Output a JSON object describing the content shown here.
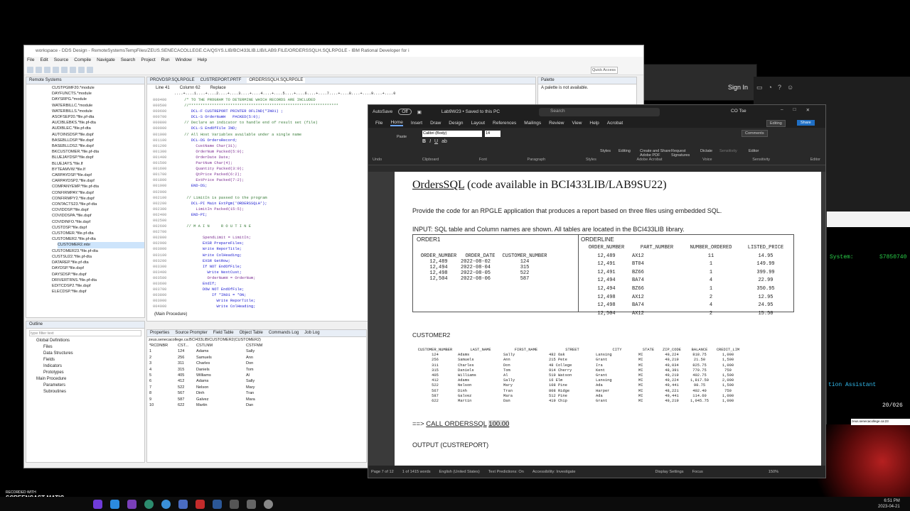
{
  "back_window": {
    "signin": "Sign In"
  },
  "terminal": {
    "line1_label": "System:",
    "line1_value": "S7850740",
    "assistant": "tion Assistant",
    "page": "20/026",
    "address": "zeus.senecacollege.ca:23"
  },
  "eclipse": {
    "title": "workspace - DDS Design - RemoteSystemsTempFiles/ZEUS.SENECACOLLEGE.CA/QSYS.LIB/BCI433LIB.LIB/LAB9.FILE/ORDERSSQLH.SQLRPGLE - IBM Rational Developer for i",
    "menu": [
      "File",
      "Edit",
      "Source",
      "Compile",
      "Navigate",
      "Search",
      "Project",
      "Run",
      "Window",
      "Help"
    ],
    "quick_access": "Quick Access",
    "remote_tab": "Remote Systems",
    "tree": [
      "CUSTPGMF20.*module",
      "DAYFUNCTS.*module",
      "DAYSRPG.*module",
      "WATERBILLC.*module",
      "WATERBILLS.*module",
      "ASOFSEP20.*file.pf-dta",
      "AUCIBLEBKS.*file.pf-dta",
      "AUDIBLEC.*file.pf-dta",
      "AUTOINSDSP.*file.dspf",
      "BASEBLLDSP.*file.dspf",
      "BASEBLLDS2.*file.dspf",
      "BKCUSTOMER.*file.pf-dta",
      "BLUEJAYDSP.*file.dspf",
      "BLUEJAYS.*file.lf",
      "BYTEAMVW.*file.lf",
      "CARPAYDSP.*file.dspf",
      "CARPAYDSP2.*file.dspf",
      "COMPANYEMP.*file.pf-dta",
      "CONFIRMPAY.*file.dspf",
      "CONFIRMPY2.*file.dspf",
      "CONTACTS23.*file.pf-dta",
      "COVIDDSP.*file.dspf",
      "COVIDDSPA.*file.dspf",
      "COVIDINFO.*file.dspf",
      "CUSTDSP.*file.dspf",
      "CUSTOMER.*file.pf-dta",
      "CUSTOMER2.*file.pf-dta",
      "CUSTOMER2.mbr",
      "CUSTOMER23.*file.pf-dta",
      "CUSTSU22.*file.pf-dta",
      "DATAREP.*file.pf-dta",
      "DAYDSP.*file.dspf",
      "DAYSDSP.*file.dspf",
      "DRIVERTRNS.*file.pf-dta",
      "EDITCDSP2.*file.dspf",
      "ELECDSP.*file.dspf"
    ],
    "editor_tabs": [
      "PROVDSP.SQLRPGLE",
      "CUSTREPORT.PRTF",
      "ORDERSSQLH.SQLRPGLE"
    ],
    "line_info": "Line 41",
    "col_info": "Column 62",
    "mode": "Replace",
    "ruler": "....+....1....+....2....+....3....+....4....+....5....+....6....+....7....+....8....+....9....+....0",
    "code": [
      {
        "n": "000400",
        "t": "     /* TO THE PROGRAM TO DETERMINE WHICH RECORDS ARE INCLUDED",
        "c": "c"
      },
      {
        "n": "000500",
        "t": "     //*****************************************************************",
        "c": "c"
      },
      {
        "n": "000600",
        "t": "        DCL-F CUSTREPORT PRINTER OFLIND(*IN01) ;",
        "c": "k"
      },
      {
        "n": "000700",
        "t": "        DCL-S OrderNumH   PACKED(5:0);",
        "c": "k"
      },
      {
        "n": "000800",
        "t": "     // Declare an indicator to handle end of result set (file)",
        "c": "c"
      },
      {
        "n": "000900",
        "t": "        DCL-S EndOfFile IND;",
        "c": "k"
      },
      {
        "n": "001000",
        "t": "     // All Host Variables available under a single name",
        "c": "c"
      },
      {
        "n": "001100",
        "t": "        DCL-DS OrdersRecord;",
        "c": "k"
      },
      {
        "n": "001200",
        "t": "          CustName Char(31);",
        "c": "t"
      },
      {
        "n": "001300",
        "t": "          OrderNum Packed(5:0);",
        "c": "t"
      },
      {
        "n": "001400",
        "t": "          OrderDate Date;",
        "c": "t"
      },
      {
        "n": "001500",
        "t": "          PartNum Char(4);",
        "c": "t"
      },
      {
        "n": "001600",
        "t": "          Quantity Packed(3:0);",
        "c": "t"
      },
      {
        "n": "001700",
        "t": "          QtPrice Packed(6:2);",
        "c": "t"
      },
      {
        "n": "001800",
        "t": "          ExtPrice Packed(7:2);",
        "c": "t"
      },
      {
        "n": "001900",
        "t": "        END-DS;",
        "c": "k"
      },
      {
        "n": "002000",
        "t": "",
        "c": "t"
      },
      {
        "n": "002100",
        "t": "      // LimitIn is passed to the program",
        "c": "c"
      },
      {
        "n": "002200",
        "t": "        DCL-PI Main ExtPgm('ORDERSSQLH');",
        "c": "k"
      },
      {
        "n": "002300",
        "t": "          LimitIn Packed(15:5);",
        "c": "t"
      },
      {
        "n": "002400",
        "t": "        END-PI;",
        "c": "k"
      },
      {
        "n": "002500",
        "t": "",
        "c": "t"
      },
      {
        "n": "002600",
        "t": "      // M A I N     R O U T I N E",
        "c": "c"
      },
      {
        "n": "002700",
        "t": "",
        "c": "t"
      },
      {
        "n": "002800",
        "t": "             SpendLimit = LimitIn;",
        "c": "t"
      },
      {
        "n": "002900",
        "t": "             EXSR PrepareFiles;",
        "c": "k"
      },
      {
        "n": "003000",
        "t": "             Write ReporTitle;",
        "c": "k"
      },
      {
        "n": "003100",
        "t": "             Write ColHeading;",
        "c": "k"
      },
      {
        "n": "003200",
        "t": "             EXSR GetRow;",
        "c": "k"
      },
      {
        "n": "003300",
        "t": "             If NOT EndOfFile;",
        "c": "k"
      },
      {
        "n": "003400",
        "t": "               Write NextCust;",
        "c": "k"
      },
      {
        "n": "003500",
        "t": "               OrderNumH = OrderNum;",
        "c": "t"
      },
      {
        "n": "003600",
        "t": "             EndIf;",
        "c": "k"
      },
      {
        "n": "003700",
        "t": "             DOW NOT EndOfFile;",
        "c": "k"
      },
      {
        "n": "003800",
        "t": "                 If *IN01 = *ON;",
        "c": "k"
      },
      {
        "n": "003900",
        "t": "                   Write ReporTitle;",
        "c": "k"
      },
      {
        "n": "004000",
        "t": "                   Write ColHeading;",
        "c": "k"
      },
      {
        "n": "004100",
        "t": "                 *IN01 = *OFF;",
        "c": "s"
      }
    ],
    "main_proc": "(Main Procedure)",
    "palette_tab": "Palette",
    "palette_msg": "A palette is not available.",
    "outline_tab": "Outline",
    "outline_filter": "type filter text",
    "outline_tree": [
      {
        "label": "Global Definitions",
        "lvl": 0
      },
      {
        "label": "Files",
        "lvl": 1
      },
      {
        "label": "Data Structures",
        "lvl": 1
      },
      {
        "label": "Fields",
        "lvl": 1
      },
      {
        "label": "Indicators",
        "lvl": 1
      },
      {
        "label": "Prototypes",
        "lvl": 1
      },
      {
        "label": "Main Procedure",
        "lvl": 0
      },
      {
        "label": "Parameters",
        "lvl": 1
      },
      {
        "label": "Subroutines",
        "lvl": 1
      }
    ],
    "bottom_tabs": [
      "Properties",
      "Source Prompter",
      "Field Table",
      "Object Table",
      "Commands Log",
      "Job Log"
    ],
    "bottom_path": "zeus.senecacollege.ca:BCI433LIB/CUSTOMER2(CUSTOMER2)",
    "grid_headers": [
      "*RCDNBR",
      "CST...",
      "CSTLNM",
      "CSTFNM"
    ],
    "grid_rows": [
      [
        "1",
        "124",
        "Adams",
        "Sally"
      ],
      [
        "2",
        "256",
        "Samuels",
        "Ann"
      ],
      [
        "3",
        "311",
        "Charles",
        "Don"
      ],
      [
        "4",
        "315",
        "Daniels",
        "Tom"
      ],
      [
        "5",
        "405",
        "Williams",
        "Al"
      ],
      [
        "6",
        "412",
        "Adams",
        "Sally"
      ],
      [
        "7",
        "522",
        "Nelson",
        "Mary"
      ],
      [
        "8",
        "567",
        "Dinh",
        "Tran"
      ],
      [
        "9",
        "587",
        "Galvez",
        "Mara"
      ],
      [
        "10",
        "622",
        "Martin",
        "Dan"
      ]
    ]
  },
  "word": {
    "autosave": "AutoSave",
    "autosave_state": "Off",
    "doc_title": "Lab9W23 • Saved to this PC",
    "search": "Search",
    "user": "CO Tse",
    "menu": [
      "File",
      "Home",
      "Insert",
      "Draw",
      "Design",
      "Layout",
      "References",
      "Mailings",
      "Review",
      "View",
      "Help",
      "Acrobat"
    ],
    "comments": "Comments",
    "editing": "Editing",
    "share": "Share",
    "font": "Calibri (Body)",
    "font_size": "14",
    "groups": [
      "Undo",
      "Clipboard",
      "Font",
      "Paragraph",
      "Styles",
      "Adobe Acrobat",
      "Voice",
      "Sensitivity",
      "Editor"
    ],
    "ribbon_buttons": [
      "Paste",
      "Styles",
      "Editing",
      "Create and Share Adobe PDF",
      "Request Signatures",
      "Dictate",
      "Sensitivity",
      "Editor"
    ],
    "heading_main": "OrdersSQL",
    "heading_rest": " (code available in BCI433LIB/LAB9SU22)",
    "para1": "Provide the code for an RPGLE application that produces a report based on three files using embedded SQL.",
    "para2": "INPUT: SQL table and Column names are shown. All tables are located in the BCI433LIB library.",
    "order1": {
      "title": "ORDER1",
      "headers": [
        "ORDER_NUMBER",
        "ORDER_DATE",
        "CUSTOMER_NUMBER"
      ],
      "rows": [
        [
          "12,489",
          "2022-08-02",
          "124"
        ],
        [
          "12,494",
          "2022-08-04",
          "315"
        ],
        [
          "12,498",
          "2022-08-05",
          "522"
        ],
        [
          "12,504",
          "2022-08-06",
          "587"
        ]
      ]
    },
    "orderline": {
      "title": "ORDERLINE",
      "headers": [
        "ORDER_NUMBER",
        "PART_NUMBER",
        "NUMBER_ORDERED",
        "LISTED_PRICE"
      ],
      "rows": [
        [
          "12,489",
          "AX12",
          "11",
          "14.95"
        ],
        [
          "12,491",
          "BT04",
          "1",
          "149.99"
        ],
        [
          "12,491",
          "BZ66",
          "1",
          "399.99"
        ],
        [
          "12,494",
          "BA74",
          "4",
          "22.99"
        ],
        [
          "12,494",
          "BZ66",
          "1",
          "350.95"
        ],
        [
          "12,498",
          "AX12",
          "2",
          "12.95"
        ],
        [
          "12,498",
          "BA74",
          "4",
          "24.95"
        ],
        [
          "12,504",
          "AX12",
          "2",
          "15.50"
        ]
      ]
    },
    "customer2": {
      "title": "CUSTOMER2",
      "headers": [
        "CUSTOMER_NUMBER",
        "LAST_NAME",
        "FIRST_NAME",
        "STREET",
        "CITY",
        "STATE",
        "ZIP_CODE",
        "BALANCE",
        "CREDIT_LIM"
      ],
      "rows": [
        [
          "124",
          "Adams",
          "Sally",
          "482 Oak",
          "Lansing",
          "MI",
          "49,224",
          "818.75",
          "1,000"
        ],
        [
          "256",
          "Samuels",
          "Ann",
          "215 Pete",
          "Grant",
          "MI",
          "49,219",
          "21.50",
          "1,500"
        ],
        [
          "311",
          "Charles",
          "Don",
          "48 College",
          "Ira",
          "MI",
          "49,034",
          "825.75",
          "1,000"
        ],
        [
          "315",
          "Daniels",
          "Tom",
          "914 Cherry",
          "Kent",
          "MI",
          "48,391",
          "770.75",
          "750"
        ],
        [
          "405",
          "Williams",
          "Al",
          "519 Watson",
          "Grant",
          "MI",
          "49,219",
          "402.75",
          "1,500"
        ],
        [
          "412",
          "Adams",
          "Sally",
          "16 Elm",
          "Lansing",
          "MI",
          "49,224",
          "1,817.50",
          "2,000"
        ],
        [
          "522",
          "Nelson",
          "Mary",
          "108 Pine",
          "Ada",
          "MI",
          "49,441",
          "98.75",
          "1,500"
        ],
        [
          "567",
          "Dinh",
          "Tran",
          "808 Ridge",
          "Harper",
          "MI",
          "48,221",
          "402.40",
          "750"
        ],
        [
          "587",
          "Galvez",
          "Mara",
          "512 Pine",
          "Ada",
          "MI",
          "49,441",
          "114.60",
          "1,000"
        ],
        [
          "622",
          "Martin",
          "Dan",
          "419 Chip",
          "Grant",
          "MI",
          "49,219",
          "1,045.75",
          "1,000"
        ]
      ]
    },
    "call_prefix": "==> ",
    "call_cmd": "CALL  ORDERSSQL",
    "call_arg": "100.00",
    "output": "OUTPUT (CUSTREPORT)",
    "status": {
      "page": "Page 7 of 12",
      "words": "1 of 1415 words",
      "lang": "English (United States)",
      "predictions": "Text Predictions: On",
      "access": "Accessibility: Investigate",
      "display": "Display Settings",
      "focus": "Focus",
      "zoom": "150%"
    }
  },
  "recorder": {
    "line1": "RECORDED WITH",
    "line2": "SCREENCAST",
    "line3": "MATIC"
  },
  "clock": {
    "time": "6:51 PM",
    "date": "2023-04-21"
  }
}
